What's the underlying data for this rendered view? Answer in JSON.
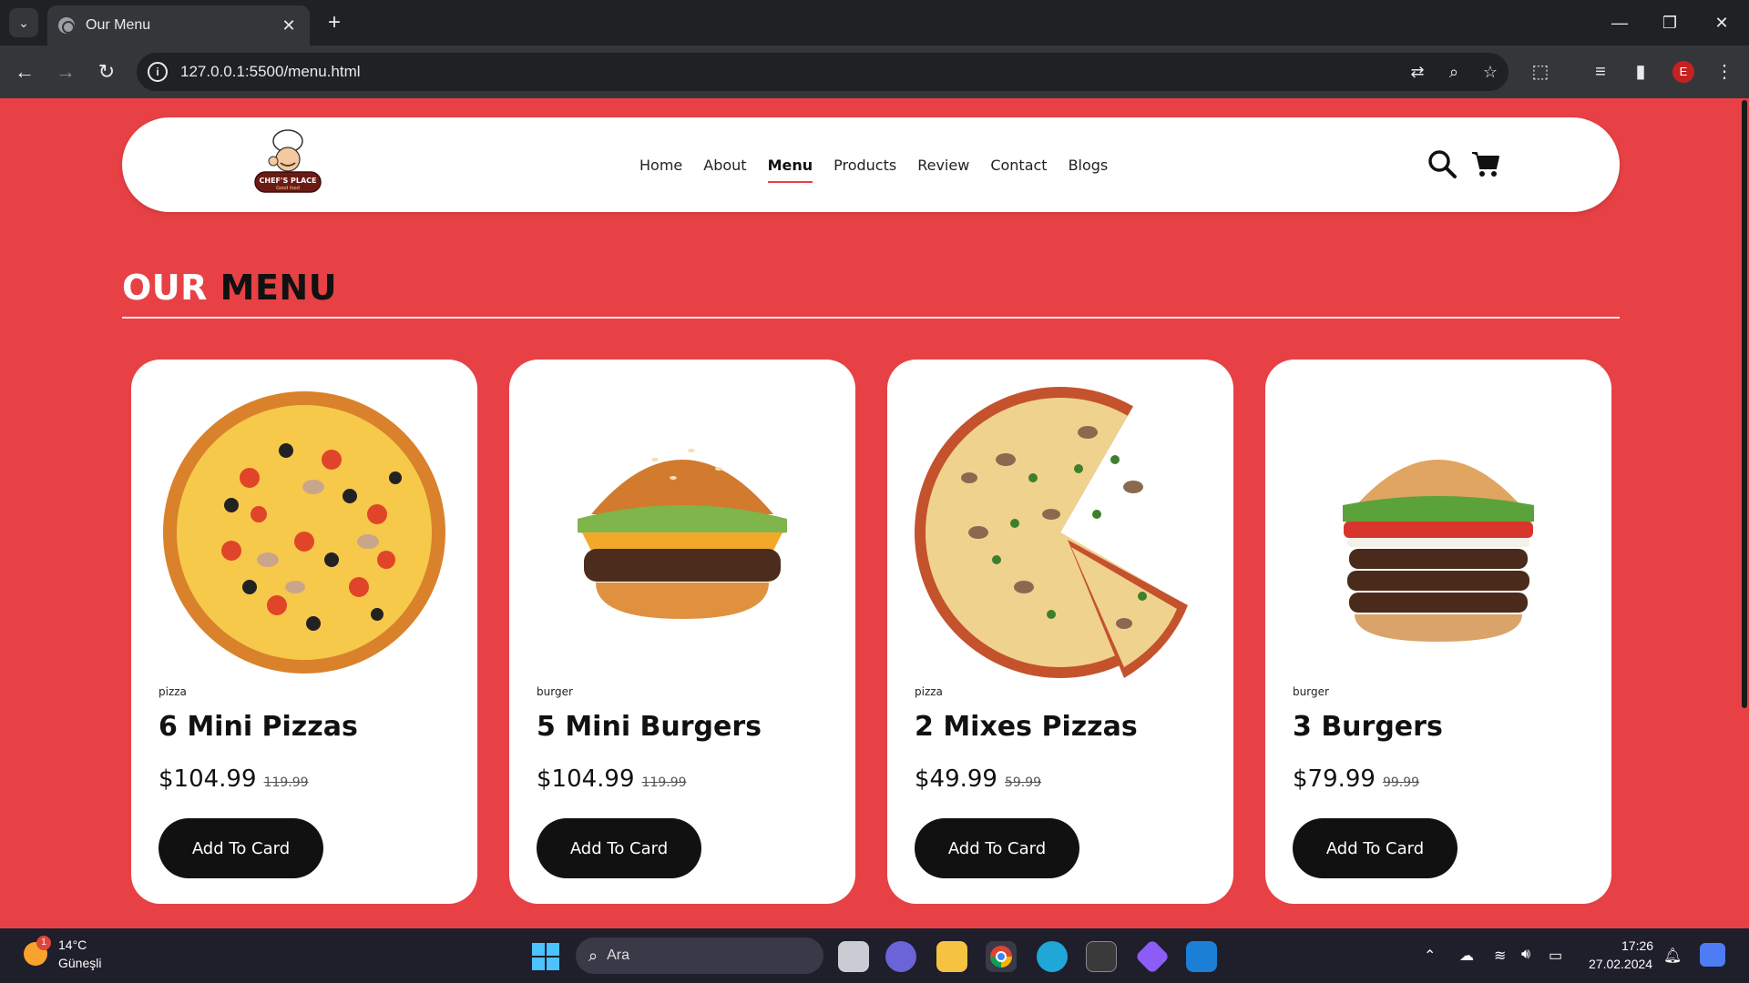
{
  "browser": {
    "tab_title": "Our Menu",
    "url": "127.0.0.1:5500/menu.html",
    "profile_initial": "E"
  },
  "site": {
    "logo_text": "CHEF'S PLACE",
    "logo_subtext": "Good food",
    "nav": [
      "Home",
      "About",
      "Menu",
      "Products",
      "Review",
      "Contact",
      "Blogs"
    ],
    "active_nav": "Menu"
  },
  "section": {
    "title_part1": "OUR",
    "title_part2": "MENU"
  },
  "products": [
    {
      "category": "pizza",
      "name": "6 Mini Pizzas",
      "price": "$104.99",
      "old_price": "119.99",
      "button": "Add To Card",
      "image": "pizza-icon"
    },
    {
      "category": "burger",
      "name": "5 Mini Burgers",
      "price": "$104.99",
      "old_price": "119.99",
      "button": "Add To Card",
      "image": "burger-icon"
    },
    {
      "category": "pizza",
      "name": "2 Mixes Pizzas",
      "price": "$49.99",
      "old_price": "59.99",
      "button": "Add To Card",
      "image": "pizza-icon"
    },
    {
      "category": "burger",
      "name": "3 Burgers",
      "price": "$79.99",
      "old_price": "99.99",
      "button": "Add To Card",
      "image": "burger-icon"
    }
  ],
  "taskbar": {
    "weather_temp": "14°C",
    "weather_desc": "Güneşli",
    "weather_badge": "1",
    "search_placeholder": "Ara",
    "time": "17:26",
    "date": "27.02.2024"
  },
  "colors": {
    "page_bg": "#e84145",
    "accent": "#e84145",
    "button_bg": "#111111"
  }
}
